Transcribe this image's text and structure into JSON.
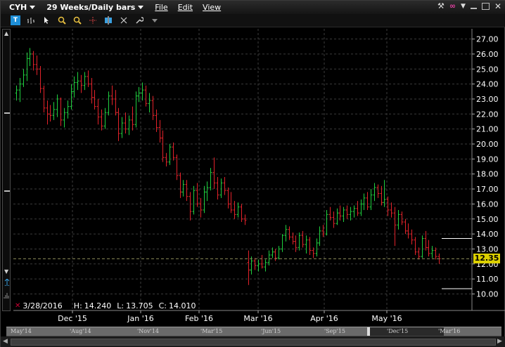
{
  "header": {
    "symbol": "CYH",
    "period": "29 Weeks/Daily bars",
    "menus": [
      {
        "label": "File"
      },
      {
        "label": "Edit"
      },
      {
        "label": "View"
      }
    ]
  },
  "toolbar": {
    "icons": [
      "text-tool-icon",
      "bar-chart-icon",
      "cursor-icon",
      "zoom-in-icon",
      "zoom-out-icon",
      "crosshair-icon",
      "split-icon",
      "collapse-icon",
      "settings-icon",
      "dropdown-icon"
    ]
  },
  "readout": {
    "date": "3/28/2016",
    "high_label": "H:",
    "high": "14.240",
    "low_label": "L:",
    "low": "13.705",
    "close_label": "C:",
    "close": "14.010"
  },
  "price_tag": "12.35",
  "navigator": {
    "labels": [
      "May'14",
      "'Aug'14",
      "'Nov'14",
      "'Mar'15",
      "'Jun'15",
      "'Sep'15",
      "'Dec'15",
      "'Mar'16"
    ]
  },
  "chart_data": {
    "type": "ohlc",
    "title": "",
    "xlabel": "",
    "ylabel": "",
    "ylim": [
      9.4,
      27.5
    ],
    "y_ticks": [
      "10.00",
      "11.00",
      "12.00",
      "13.00",
      "14.00",
      "15.00",
      "16.00",
      "17.00",
      "18.00",
      "19.00",
      "20.00",
      "21.00",
      "22.00",
      "23.00",
      "24.00",
      "25.00",
      "26.00",
      "27.00"
    ],
    "x_ticks": [
      "Dec '15",
      "Jan '16",
      "Feb '16",
      "Mar '16",
      "Apr '16",
      "May '16"
    ],
    "grid": true,
    "up_color": "#1fcf3f",
    "down_color": "#e2222a",
    "last_price": 12.35,
    "reference_lines": [
      13.7,
      10.35
    ],
    "bars": [
      [
        23.4,
        23.9,
        22.9,
        23.6
      ],
      [
        23.6,
        24.4,
        22.8,
        24.0
      ],
      [
        24.0,
        25.0,
        23.8,
        24.6
      ],
      [
        24.6,
        26.1,
        24.2,
        25.7
      ],
      [
        25.7,
        26.4,
        25.2,
        26.0
      ],
      [
        26.0,
        26.2,
        24.9,
        25.3
      ],
      [
        25.3,
        25.9,
        24.6,
        25.0
      ],
      [
        25.0,
        25.2,
        23.4,
        23.7
      ],
      [
        23.7,
        23.9,
        22.1,
        22.4
      ],
      [
        22.4,
        22.9,
        21.3,
        22.0
      ],
      [
        22.0,
        22.6,
        21.5,
        21.9
      ],
      [
        21.9,
        22.8,
        21.6,
        22.3
      ],
      [
        22.3,
        23.3,
        21.8,
        23.0
      ],
      [
        23.0,
        23.1,
        21.2,
        21.6
      ],
      [
        21.6,
        22.4,
        21.1,
        22.1
      ],
      [
        22.1,
        22.9,
        21.7,
        22.5
      ],
      [
        22.5,
        24.0,
        22.3,
        23.5
      ],
      [
        23.5,
        24.5,
        23.1,
        24.1
      ],
      [
        24.1,
        24.8,
        23.6,
        24.2
      ],
      [
        24.2,
        24.6,
        23.4,
        23.9
      ],
      [
        23.9,
        24.8,
        23.6,
        24.5
      ],
      [
        24.5,
        24.9,
        23.8,
        24.0
      ],
      [
        24.0,
        24.4,
        22.7,
        23.1
      ],
      [
        23.1,
        23.6,
        22.3,
        22.5
      ],
      [
        22.5,
        23.0,
        21.3,
        21.8
      ],
      [
        21.8,
        22.3,
        20.9,
        21.2
      ],
      [
        21.2,
        22.4,
        21.0,
        22.1
      ],
      [
        22.1,
        23.5,
        21.9,
        23.2
      ],
      [
        23.2,
        23.9,
        22.6,
        23.0
      ],
      [
        23.0,
        23.6,
        21.9,
        22.1
      ],
      [
        22.1,
        22.4,
        20.2,
        20.7
      ],
      [
        20.7,
        21.8,
        20.4,
        21.4
      ],
      [
        21.4,
        22.1,
        20.7,
        21.0
      ],
      [
        21.0,
        21.9,
        20.6,
        21.6
      ],
      [
        21.6,
        22.5,
        20.9,
        21.3
      ],
      [
        21.3,
        23.5,
        21.1,
        23.2
      ],
      [
        23.2,
        23.8,
        22.8,
        23.4
      ],
      [
        23.4,
        24.1,
        22.9,
        23.6
      ],
      [
        23.6,
        23.9,
        22.5,
        22.7
      ],
      [
        22.7,
        23.4,
        22.1,
        22.9
      ],
      [
        22.9,
        23.2,
        21.6,
        21.9
      ],
      [
        21.9,
        22.3,
        20.8,
        21.1
      ],
      [
        21.1,
        21.6,
        20.1,
        20.4
      ],
      [
        20.4,
        20.9,
        18.8,
        19.1
      ],
      [
        19.1,
        19.4,
        18.5,
        18.8
      ],
      [
        18.8,
        20.0,
        18.6,
        19.8
      ],
      [
        19.8,
        20.1,
        18.9,
        19.1
      ],
      [
        19.1,
        19.3,
        17.6,
        17.9
      ],
      [
        17.9,
        18.1,
        16.4,
        16.8
      ],
      [
        16.8,
        17.6,
        16.5,
        17.3
      ],
      [
        17.3,
        17.6,
        16.2,
        16.5
      ],
      [
        16.5,
        16.8,
        14.9,
        15.5
      ],
      [
        15.5,
        17.2,
        15.3,
        16.9
      ],
      [
        16.9,
        17.4,
        15.8,
        16.0
      ],
      [
        16.0,
        16.4,
        15.1,
        15.6
      ],
      [
        15.6,
        17.2,
        15.4,
        16.8
      ],
      [
        16.8,
        17.5,
        16.2,
        17.1
      ],
      [
        17.1,
        18.4,
        16.9,
        18.1
      ],
      [
        18.1,
        19.1,
        17.0,
        17.4
      ],
      [
        17.4,
        17.8,
        16.3,
        16.6
      ],
      [
        16.6,
        17.7,
        16.4,
        17.4
      ],
      [
        17.4,
        17.8,
        16.6,
        16.9
      ],
      [
        16.9,
        17.1,
        15.7,
        16.0
      ],
      [
        16.0,
        16.8,
        15.4,
        15.6
      ],
      [
        15.6,
        16.2,
        15.0,
        15.3
      ],
      [
        15.3,
        16.1,
        15.1,
        15.8
      ],
      [
        15.8,
        16.0,
        14.8,
        15.0
      ],
      [
        15.0,
        15.3,
        14.6,
        14.9
      ],
      [
        12.1,
        12.9,
        10.6,
        11.6
      ],
      [
        11.6,
        12.5,
        11.3,
        12.2
      ],
      [
        12.2,
        12.4,
        11.6,
        11.9
      ],
      [
        11.9,
        12.3,
        11.5,
        12.0
      ],
      [
        12.0,
        12.6,
        11.7,
        11.8
      ],
      [
        11.8,
        12.3,
        11.5,
        12.1
      ],
      [
        12.1,
        12.9,
        11.9,
        12.6
      ],
      [
        12.6,
        13.1,
        12.4,
        12.8
      ],
      [
        12.8,
        13.0,
        12.2,
        12.4
      ],
      [
        12.4,
        13.2,
        12.3,
        13.0
      ],
      [
        13.0,
        14.0,
        12.8,
        13.9
      ],
      [
        13.9,
        14.6,
        13.5,
        14.3
      ],
      [
        14.3,
        14.5,
        13.6,
        13.8
      ],
      [
        13.8,
        14.1,
        13.3,
        13.5
      ],
      [
        13.5,
        13.9,
        12.8,
        13.1
      ],
      [
        13.1,
        14.1,
        12.9,
        13.9
      ],
      [
        13.9,
        14.2,
        13.1,
        13.3
      ],
      [
        13.3,
        13.9,
        12.7,
        13.6
      ],
      [
        13.6,
        13.8,
        12.6,
        12.9
      ],
      [
        12.9,
        13.1,
        12.4,
        12.7
      ],
      [
        12.7,
        13.7,
        12.5,
        13.4
      ],
      [
        13.4,
        14.5,
        13.2,
        14.2
      ],
      [
        14.2,
        14.6,
        13.8,
        14.0
      ],
      [
        14.0,
        15.6,
        13.9,
        15.3
      ],
      [
        15.3,
        15.8,
        14.9,
        15.1
      ],
      [
        15.1,
        15.5,
        14.4,
        14.7
      ],
      [
        14.7,
        15.7,
        14.6,
        15.4
      ],
      [
        15.4,
        15.9,
        14.9,
        15.2
      ],
      [
        15.2,
        15.8,
        14.8,
        15.6
      ],
      [
        15.6,
        15.9,
        15.0,
        15.3
      ],
      [
        15.3,
        15.8,
        14.9,
        15.5
      ],
      [
        15.5,
        15.9,
        15.1,
        15.7
      ],
      [
        15.7,
        16.2,
        15.2,
        15.4
      ],
      [
        15.4,
        16.3,
        15.2,
        16.0
      ],
      [
        16.0,
        16.7,
        15.6,
        16.4
      ],
      [
        16.4,
        16.8,
        15.6,
        15.8
      ],
      [
        15.8,
        17.0,
        15.6,
        16.6
      ],
      [
        16.6,
        17.4,
        16.2,
        17.1
      ],
      [
        17.1,
        17.3,
        16.4,
        16.7
      ],
      [
        16.7,
        17.2,
        15.9,
        16.1
      ],
      [
        16.1,
        17.6,
        15.8,
        16.3
      ],
      [
        16.3,
        16.5,
        15.2,
        15.6
      ],
      [
        15.6,
        16.1,
        15.1,
        15.4
      ],
      [
        15.4,
        15.8,
        13.2,
        14.6
      ],
      [
        14.6,
        15.6,
        14.3,
        15.3
      ],
      [
        15.3,
        15.5,
        14.6,
        14.8
      ],
      [
        14.8,
        15.0,
        14.0,
        14.2
      ],
      [
        14.2,
        14.7,
        13.7,
        14.0
      ],
      [
        14.0,
        14.3,
        13.3,
        13.6
      ],
      [
        13.6,
        13.8,
        12.6,
        12.8
      ],
      [
        12.8,
        13.1,
        12.3,
        12.5
      ],
      [
        12.5,
        13.9,
        12.4,
        13.7
      ],
      [
        13.7,
        14.2,
        12.9,
        13.1
      ],
      [
        13.1,
        13.6,
        12.5,
        12.7
      ],
      [
        12.7,
        13.2,
        12.4,
        12.9
      ],
      [
        12.9,
        13.1,
        12.3,
        12.5
      ],
      [
        12.5,
        12.7,
        12.0,
        12.35
      ]
    ]
  },
  "colors": {
    "background": "#000000",
    "grid": "#3b3b3b",
    "axis_text": "#ffffff",
    "price_tag_bg": "#dcd000",
    "toolbar_accent": "#1e8fd8"
  }
}
